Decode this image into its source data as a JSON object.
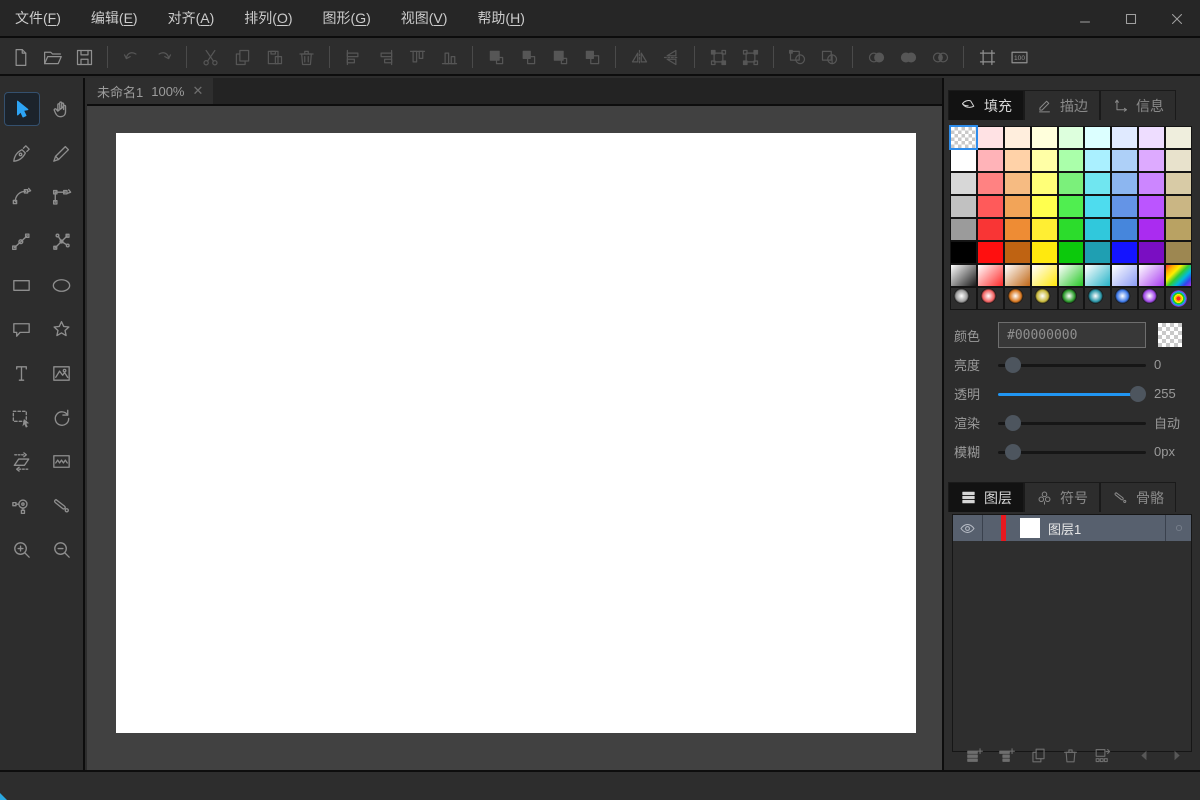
{
  "window": {
    "controls": [
      "minimize",
      "maximize",
      "close"
    ]
  },
  "menu": {
    "items": [
      {
        "label": "文件",
        "key": "F"
      },
      {
        "label": "编辑",
        "key": "E"
      },
      {
        "label": "对齐",
        "key": "A"
      },
      {
        "label": "排列",
        "key": "O"
      },
      {
        "label": "图形",
        "key": "G"
      },
      {
        "label": "视图",
        "key": "V"
      },
      {
        "label": "帮助",
        "key": "H"
      }
    ]
  },
  "toolbar": {
    "groups": [
      [
        {
          "icon": "new-file",
          "enabled": true
        },
        {
          "icon": "open-file",
          "enabled": true
        },
        {
          "icon": "save-file",
          "enabled": true
        }
      ],
      [
        {
          "icon": "undo",
          "enabled": false
        },
        {
          "icon": "redo",
          "enabled": false
        }
      ],
      [
        {
          "icon": "cut",
          "enabled": false
        },
        {
          "icon": "copy",
          "enabled": false
        },
        {
          "icon": "paste",
          "enabled": false
        },
        {
          "icon": "delete",
          "enabled": false
        }
      ],
      [
        {
          "icon": "align-left",
          "enabled": false
        },
        {
          "icon": "align-right",
          "enabled": false
        },
        {
          "icon": "align-top",
          "enabled": false
        },
        {
          "icon": "align-bottom",
          "enabled": false
        }
      ],
      [
        {
          "icon": "bring-to-front",
          "enabled": false
        },
        {
          "icon": "bring-forward",
          "enabled": false
        },
        {
          "icon": "send-backward",
          "enabled": false
        },
        {
          "icon": "send-to-back",
          "enabled": false
        }
      ],
      [
        {
          "icon": "flip-horizontal",
          "enabled": false
        },
        {
          "icon": "flip-vertical",
          "enabled": false
        }
      ],
      [
        {
          "icon": "group",
          "enabled": false
        },
        {
          "icon": "ungroup",
          "enabled": false
        }
      ],
      [
        {
          "icon": "weld-shapes",
          "enabled": false
        },
        {
          "icon": "trim-shapes",
          "enabled": false
        }
      ],
      [
        {
          "icon": "union",
          "enabled": false
        },
        {
          "icon": "intersect",
          "enabled": false
        },
        {
          "icon": "exclude",
          "enabled": false
        }
      ],
      [
        {
          "icon": "canvas-settings",
          "enabled": true
        },
        {
          "icon": "zoom-100",
          "enabled": true
        }
      ]
    ]
  },
  "document_tab": {
    "title": "未命名1",
    "zoom": "100%",
    "close_glyph": "✕"
  },
  "tools": {
    "items": [
      {
        "name": "select",
        "active": true
      },
      {
        "name": "hand",
        "active": false
      },
      {
        "name": "pen",
        "active": false
      },
      {
        "name": "pencil",
        "active": false
      },
      {
        "name": "curve",
        "active": false
      },
      {
        "name": "polyline",
        "active": false
      },
      {
        "name": "path-node",
        "active": false
      },
      {
        "name": "nodes",
        "active": false
      },
      {
        "name": "rectangle",
        "active": false
      },
      {
        "name": "ellipse",
        "active": false
      },
      {
        "name": "callout",
        "active": false
      },
      {
        "name": "star",
        "active": false
      },
      {
        "name": "text",
        "active": false
      },
      {
        "name": "image",
        "active": false
      },
      {
        "name": "marquee",
        "active": false
      },
      {
        "name": "rotate",
        "active": false
      },
      {
        "name": "skew",
        "active": false
      },
      {
        "name": "envelope",
        "active": false
      },
      {
        "name": "fill-transform",
        "active": false
      },
      {
        "name": "knife",
        "active": false
      },
      {
        "name": "zoom-in",
        "active": false
      },
      {
        "name": "zoom-out",
        "active": false
      }
    ]
  },
  "fill_panel": {
    "tabs": [
      {
        "label": "填充",
        "icon": "bucket-icon",
        "active": true
      },
      {
        "label": "描边",
        "icon": "pencil-icon",
        "active": false
      },
      {
        "label": "信息",
        "icon": "axes-icon",
        "active": false
      }
    ],
    "palette": {
      "selected_cell": [
        0,
        0
      ],
      "rows": [
        [
          "transparent",
          "#ffe2e4",
          "#ffeedd",
          "#ffffdc",
          "#ddffdd",
          "#dcffff",
          "#e0eaff",
          "#eeddff",
          "#efeedd"
        ],
        [
          "#ffffff",
          "#ffb3b8",
          "#ffd2a8",
          "#ffffa6",
          "#aaffaa",
          "#aaf0ff",
          "#aed0f8",
          "#ddaaff",
          "#e8e2cc"
        ],
        [
          "#d7d7d7",
          "#ff8282",
          "#f6bb82",
          "#ffff78",
          "#7bf07b",
          "#70e6f0",
          "#8cb6f0",
          "#cc86ff",
          "#d8cba6"
        ],
        [
          "#c1c1c1",
          "#ff5a5a",
          "#f2a458",
          "#ffff4e",
          "#50ee50",
          "#4edcee",
          "#6494e6",
          "#bb55ff",
          "#cab684"
        ],
        [
          "#9b9b9b",
          "#f93535",
          "#ee8c34",
          "#ffee33",
          "#2cdc2c",
          "#30c8dc",
          "#4686dc",
          "#aa2cf0",
          "#b9a263"
        ],
        [
          "#000000",
          "#ff0f0f",
          "#bf6312",
          "#ffe90e",
          "#0cc90c",
          "#1f9fb2",
          "#1414ff",
          "#7a0ec2",
          "#9d8751"
        ],
        [
          "grad:#1a1a1a",
          "grad:#ff2a2a",
          "grad:#c06818",
          "grad:#ffe70a",
          "grad:#28c828",
          "grad:#28b4c8",
          "grad:#8c9cf5",
          "grad:#a93df0",
          "rainbow"
        ],
        [
          "sphere:#9a9a9a",
          "sphere:#f06060",
          "sphere:#d8771e",
          "sphere:#c8b83a",
          "sphere:#2a9a2a",
          "sphere:#2a96a8",
          "sphere:#3c78e8",
          "sphere:#a048e8",
          "sphere-rainbow"
        ]
      ]
    },
    "color": {
      "label": "颜色",
      "value": "#00000000"
    },
    "sliders": [
      {
        "label": "亮度",
        "value": "0",
        "pos": 0.05,
        "accent": false
      },
      {
        "label": "透明",
        "value": "255",
        "pos": 1,
        "accent": true
      },
      {
        "label": "渲染",
        "value": "自动",
        "pos": 0.05,
        "accent": false
      },
      {
        "label": "模糊",
        "value": "0px",
        "pos": 0.05,
        "accent": false
      }
    ]
  },
  "layers_panel": {
    "tabs": [
      {
        "label": "图层",
        "icon": "layers-icon",
        "active": true
      },
      {
        "label": "符号",
        "icon": "symbols-icon",
        "active": false
      },
      {
        "label": "骨骼",
        "icon": "bones-icon",
        "active": false
      }
    ],
    "layers": [
      {
        "name": "图层1",
        "visible": true,
        "stripe_color": "#e8191f",
        "thumb_color": "#ffffff",
        "selected": true
      }
    ],
    "footer_icons": [
      "add-layer",
      "add-sublayer",
      "duplicate-layer",
      "delete-layer",
      "convert-layer",
      "prev-arrow",
      "next-arrow"
    ]
  },
  "colors": {
    "accent": "#2196f3",
    "selection_border": "#2d8ceb",
    "layer_selected_bg": "#57606e",
    "canvas_bg": "#ffffff",
    "workspace_bg": "#414141",
    "panel_bg": "#2d2d2d",
    "menubar_bg": "#262626"
  }
}
